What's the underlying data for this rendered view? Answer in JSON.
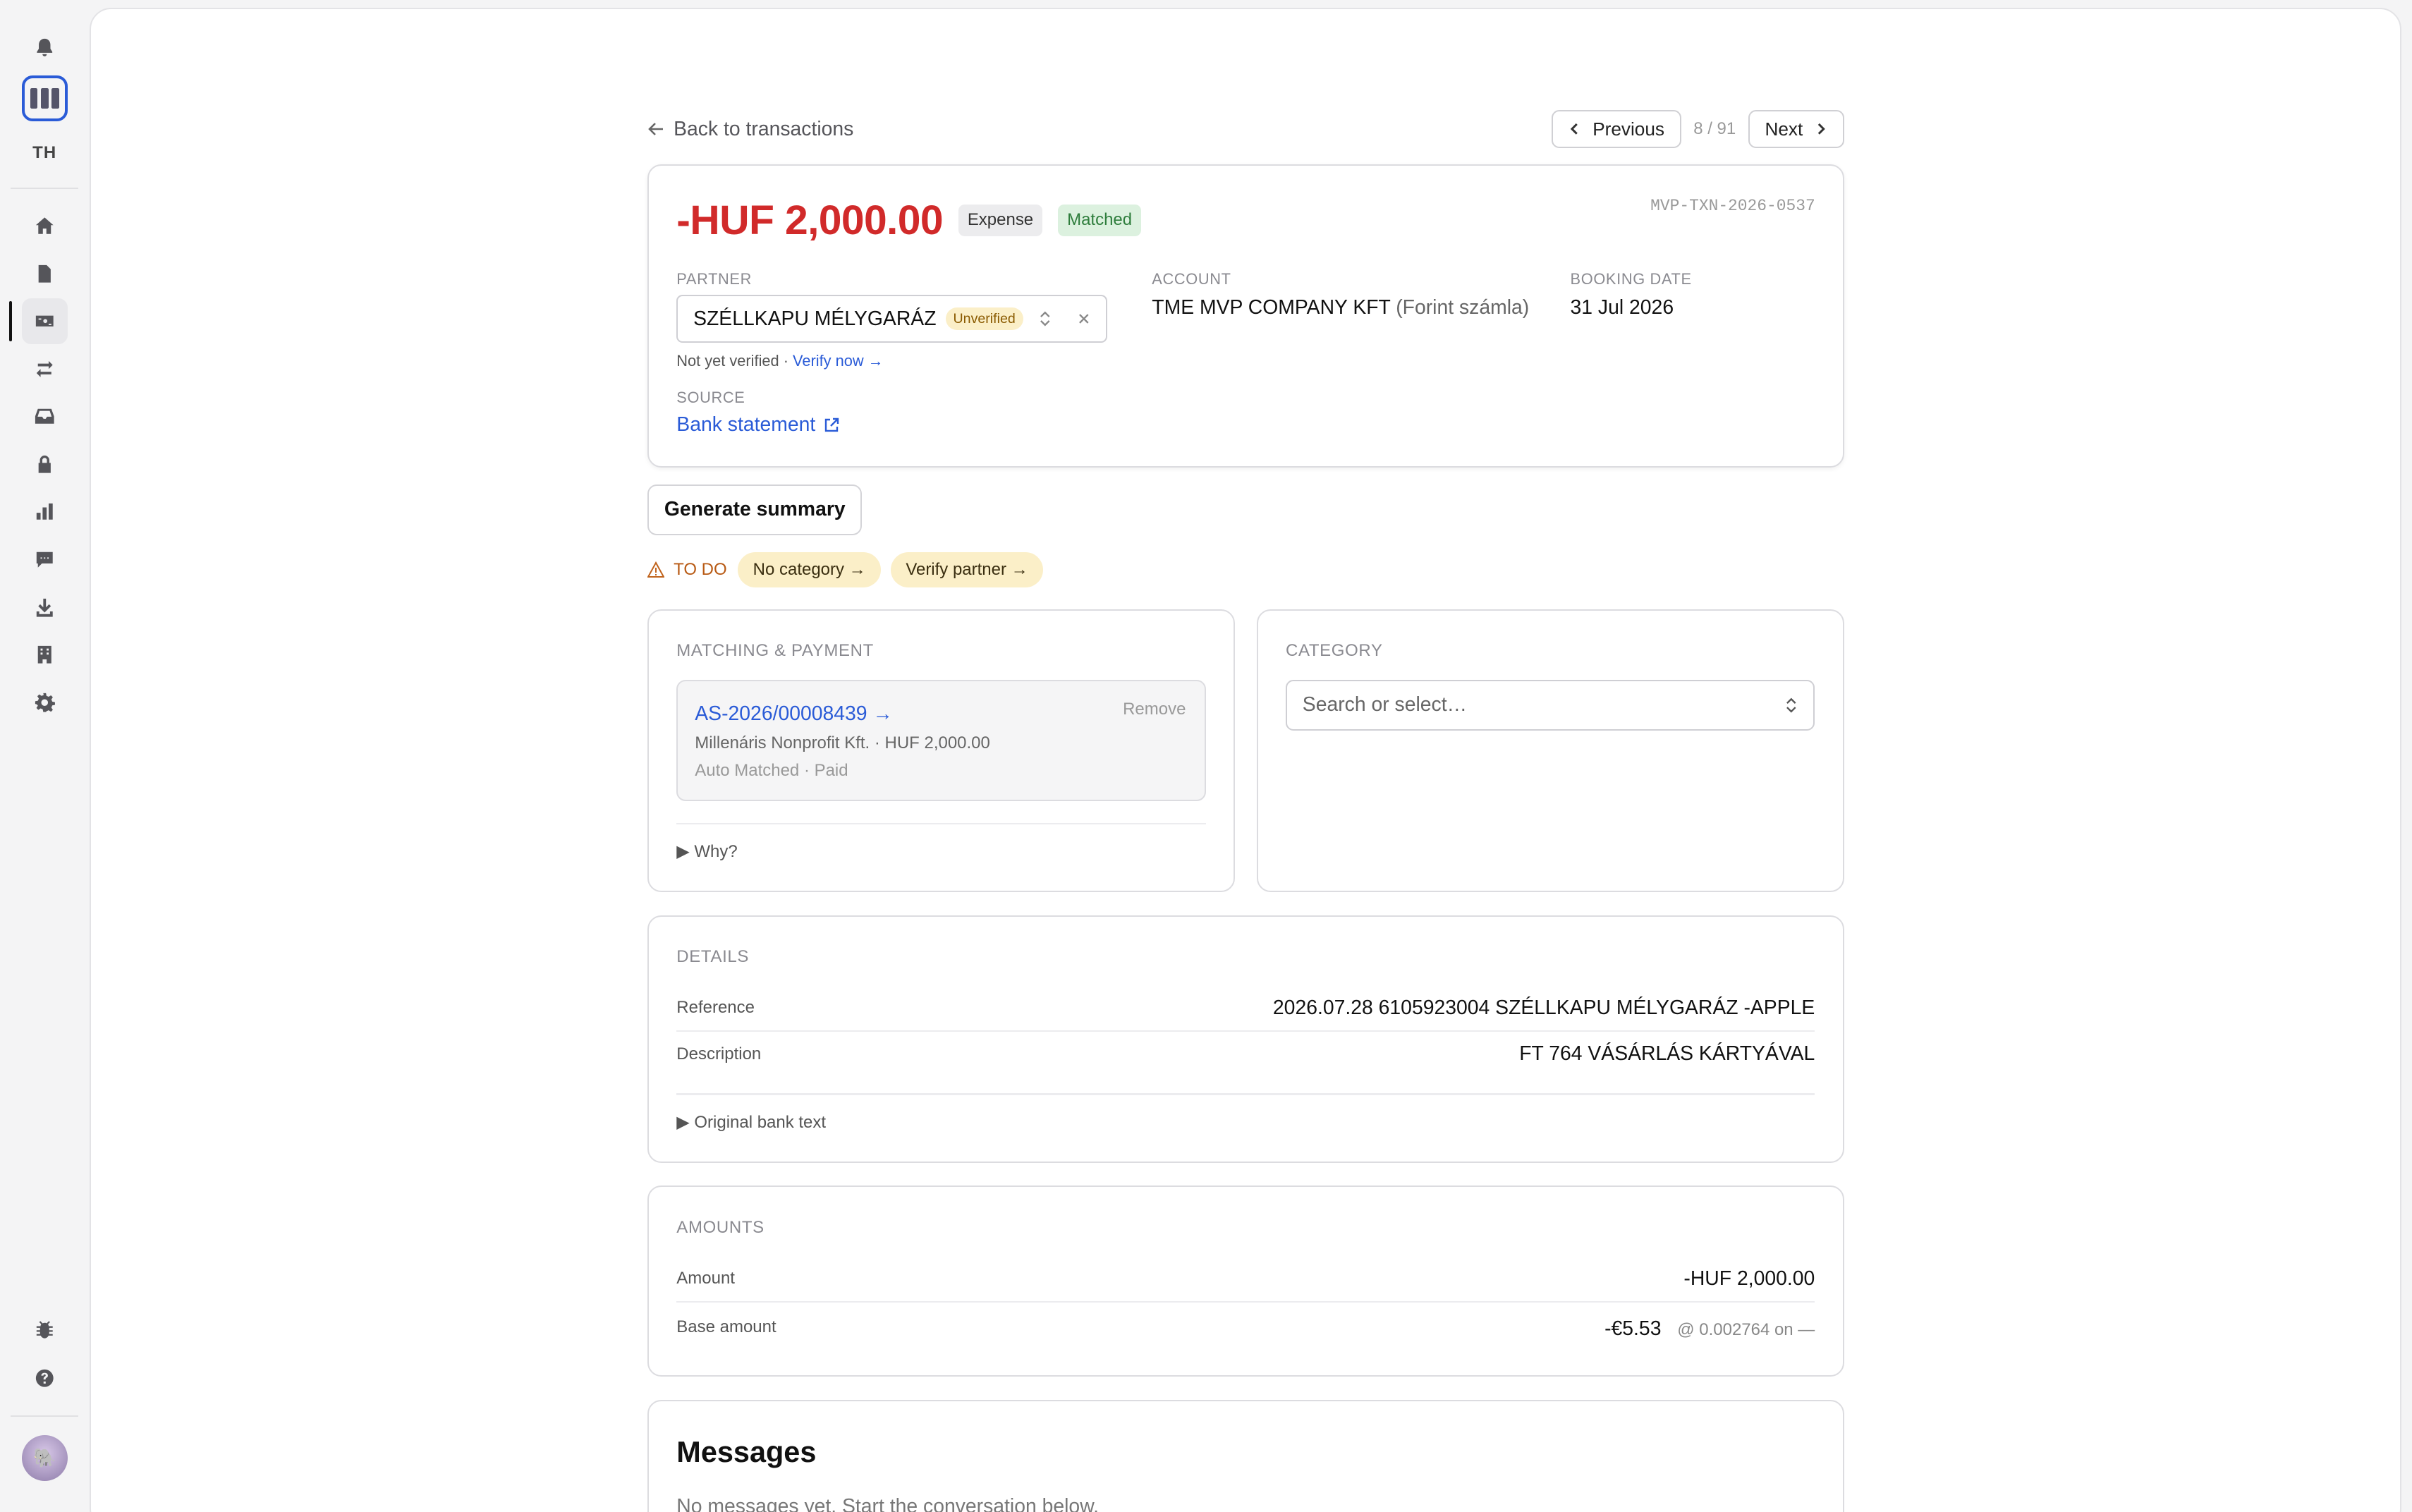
{
  "sidebar": {
    "initials": "TH",
    "nav": [
      {
        "name": "home-icon"
      },
      {
        "name": "document-icon"
      },
      {
        "name": "transactions-icon",
        "active": true
      },
      {
        "name": "transfer-icon"
      },
      {
        "name": "inbox-icon"
      },
      {
        "name": "lock-icon"
      },
      {
        "name": "reports-icon"
      },
      {
        "name": "chat-icon"
      },
      {
        "name": "download-icon"
      },
      {
        "name": "building-icon"
      },
      {
        "name": "settings-icon"
      }
    ],
    "bottom": [
      {
        "name": "bug-icon"
      },
      {
        "name": "help-icon"
      }
    ]
  },
  "topbar": {
    "back_label": "Back to transactions",
    "prev_label": "Previous",
    "next_label": "Next",
    "position": "8 / 91"
  },
  "transaction": {
    "amount": "-HUF 2,000.00",
    "type_badge": "Expense",
    "status_badge": "Matched",
    "id": "MVP-TXN-2026-0537",
    "partner_label": "PARTNER",
    "partner_name": "SZÉLLKAPU MÉLYGARÁZ",
    "partner_status": "Unverified",
    "verify_text": "Not yet verified · ",
    "verify_link": "Verify now →",
    "account_label": "ACCOUNT",
    "account_name": "TME MVP COMPANY KFT",
    "account_sub": "(Forint számla)",
    "date_label": "BOOKING DATE",
    "date_value": "31 Jul 2026",
    "source_label": "SOURCE",
    "source_value": "Bank statement"
  },
  "actions": {
    "generate_summary": "Generate summary"
  },
  "todo": {
    "label": "TO DO",
    "chips": [
      "No category →",
      "Verify partner →"
    ]
  },
  "matching": {
    "heading": "MATCHING & PAYMENT",
    "doc_id": "AS-2026/00008439 →",
    "meta": "Millenáris Nonprofit Kft. · HUF 2,000.00",
    "sub": "Auto Matched · Paid",
    "remove_label": "Remove",
    "why_label": "▶ Why?"
  },
  "category": {
    "heading": "CATEGORY",
    "placeholder": "Search or select…"
  },
  "details": {
    "heading": "DETAILS",
    "rows": [
      {
        "key": "Reference",
        "value": "2026.07.28 6105923004 SZÉLLKAPU MÉLYGARÁZ -APPLE"
      },
      {
        "key": "Description",
        "value": "FT 764 VÁSÁRLÁS KÁRTYÁVAL"
      }
    ],
    "original_toggle": "▶ Original bank text"
  },
  "amounts": {
    "heading": "AMOUNTS",
    "amount_key": "Amount",
    "amount_value": "-HUF 2,000.00",
    "base_key": "Base amount",
    "base_value": "-€5.53",
    "base_rate": "@ 0.002764 on —"
  },
  "messages": {
    "title": "Messages",
    "empty": "No messages yet. Start the conversation below."
  },
  "colors": {
    "accent": "#2a5bd7",
    "negative": "#d12a2a",
    "matched_bg": "#dcf1df",
    "warning_bg": "#fbefc8"
  }
}
